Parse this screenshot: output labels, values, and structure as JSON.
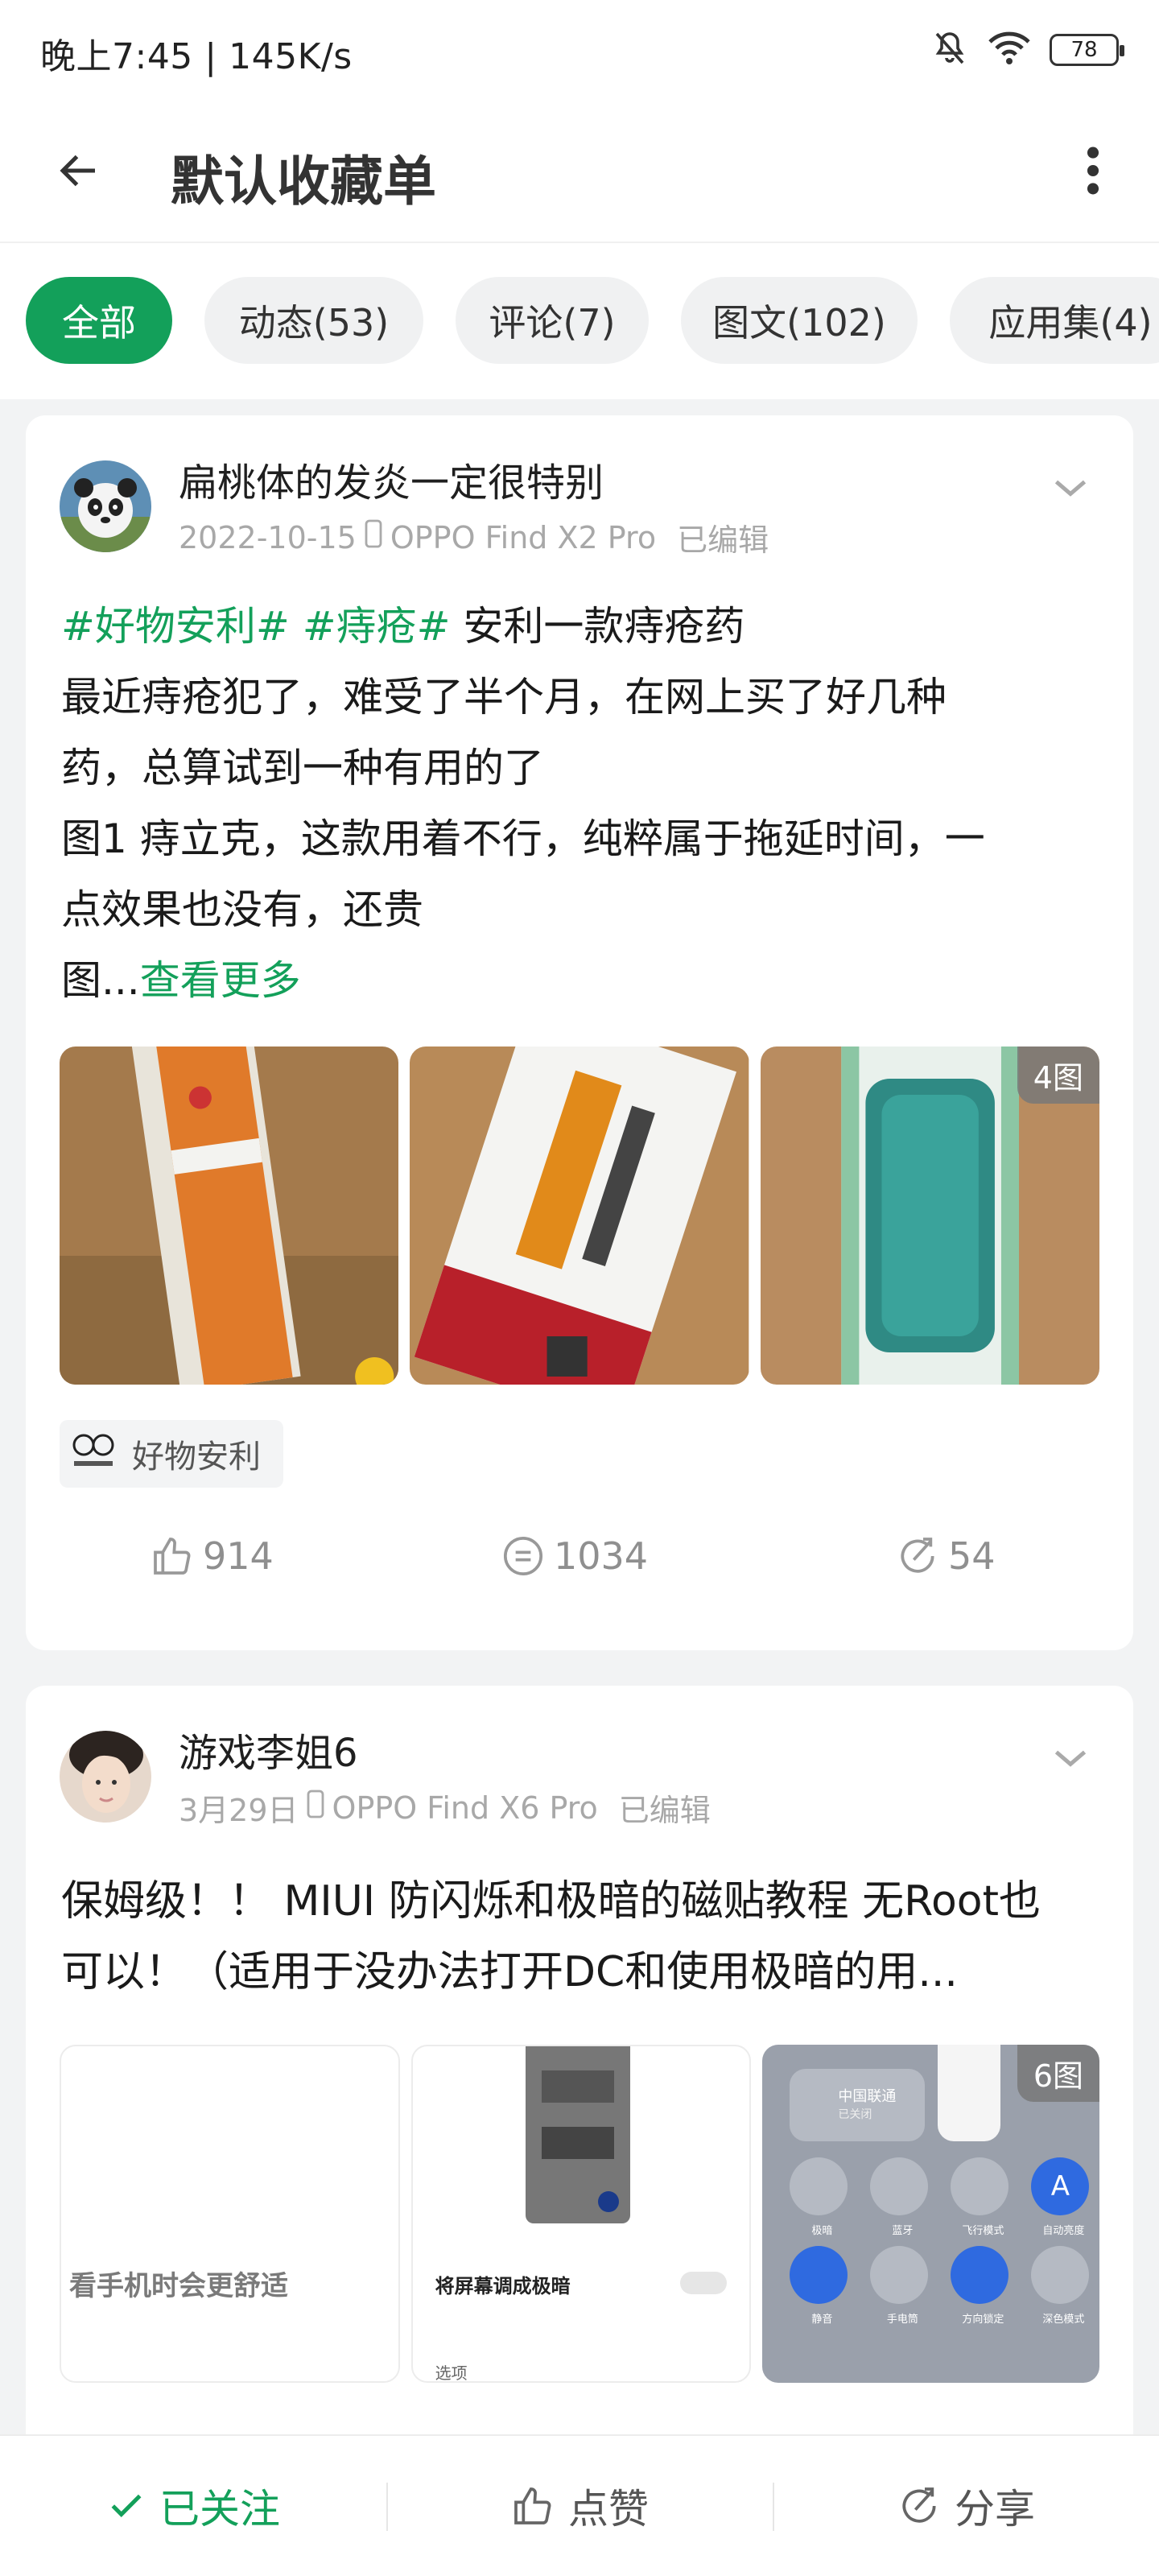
{
  "status": {
    "time": "晚上7:45 | 145K/s",
    "battery": "78"
  },
  "header": {
    "title": "默认收藏单"
  },
  "filters": [
    {
      "label": "全部",
      "active": true
    },
    {
      "label": "动态(53)"
    },
    {
      "label": "评论(7)"
    },
    {
      "label": "图文(102)"
    },
    {
      "label": "应用集(4)"
    }
  ],
  "posts": [
    {
      "author": "扁桃体的发炎一定很特别",
      "date": "2022-10-15",
      "device": "OPPO Find X2 Pro",
      "edited": "已编辑",
      "tag1": "#好物安利#",
      "tag2": "#痔疮#",
      "line1_rest": " 安利一款痔疮药",
      "line2": "最近痔疮犯了，难受了半个月，在网上买了好几种",
      "line3": "药，总算试到一种有用的了",
      "line4": "图1 痔立克，这款用着不行，纯粹属于拖延时间，一",
      "line5": "点效果也没有，还贵",
      "line6": "图...",
      "see_more": "查看更多",
      "image_count": "4图",
      "topic": "好物安利",
      "likes": "914",
      "comments": "1034",
      "shares": "54"
    },
    {
      "author": "游戏李姐6",
      "date": "3月29日",
      "device": "OPPO Find X6 Pro",
      "edited": "已编辑",
      "line1": "保姆级！！ MIUI 防闪烁和极暗的磁贴教程 无Root也",
      "line2": "可以！（适用于没办法打开DC和使用极暗的用...",
      "image_count": "6图",
      "img1_text": "看手机时会更舒适",
      "img2_text": "将屏幕调成极暗",
      "img2_sub": "选项",
      "img3_carrier": "中国联通",
      "img3_carrier_sub": "已关闭",
      "img3_labels": [
        "极暗",
        "蓝牙",
        "飞行模式",
        "自动亮度",
        "静音",
        "手电筒",
        "方向锁定",
        "深色模式"
      ]
    }
  ],
  "bottom": {
    "follow": "已关注",
    "like": "点赞",
    "share": "分享"
  }
}
